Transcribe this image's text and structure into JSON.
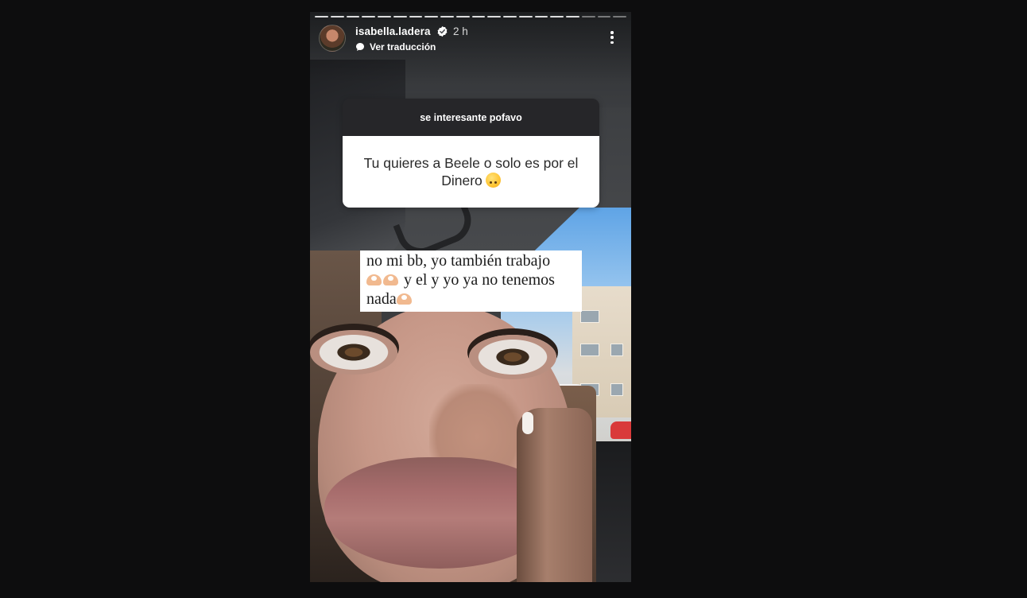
{
  "story": {
    "username": "isabella.ladera",
    "verified": true,
    "time": "2 h",
    "translate_label": "Ver traducción",
    "progress": {
      "segments": 20,
      "completed": 17
    }
  },
  "question_sticker": {
    "header": "se interesante pofavo",
    "question": "Tu quieres a Beele o solo es por el Dinero",
    "question_emoji": "upside-down-face-emoji"
  },
  "answer_sticker": {
    "line1": "no mi bb, yo también trabajo",
    "line2_text": "y el y yo ya no tenemos",
    "line3_text": "nada",
    "emoji": "heart-hands-emoji"
  },
  "colors": {
    "page_bg": "#0d0d0e",
    "question_header_bg": "#262629",
    "sticker_bg": "#ffffff"
  },
  "icons": [
    "verified-badge-icon",
    "translate-icon",
    "more-options-icon"
  ]
}
